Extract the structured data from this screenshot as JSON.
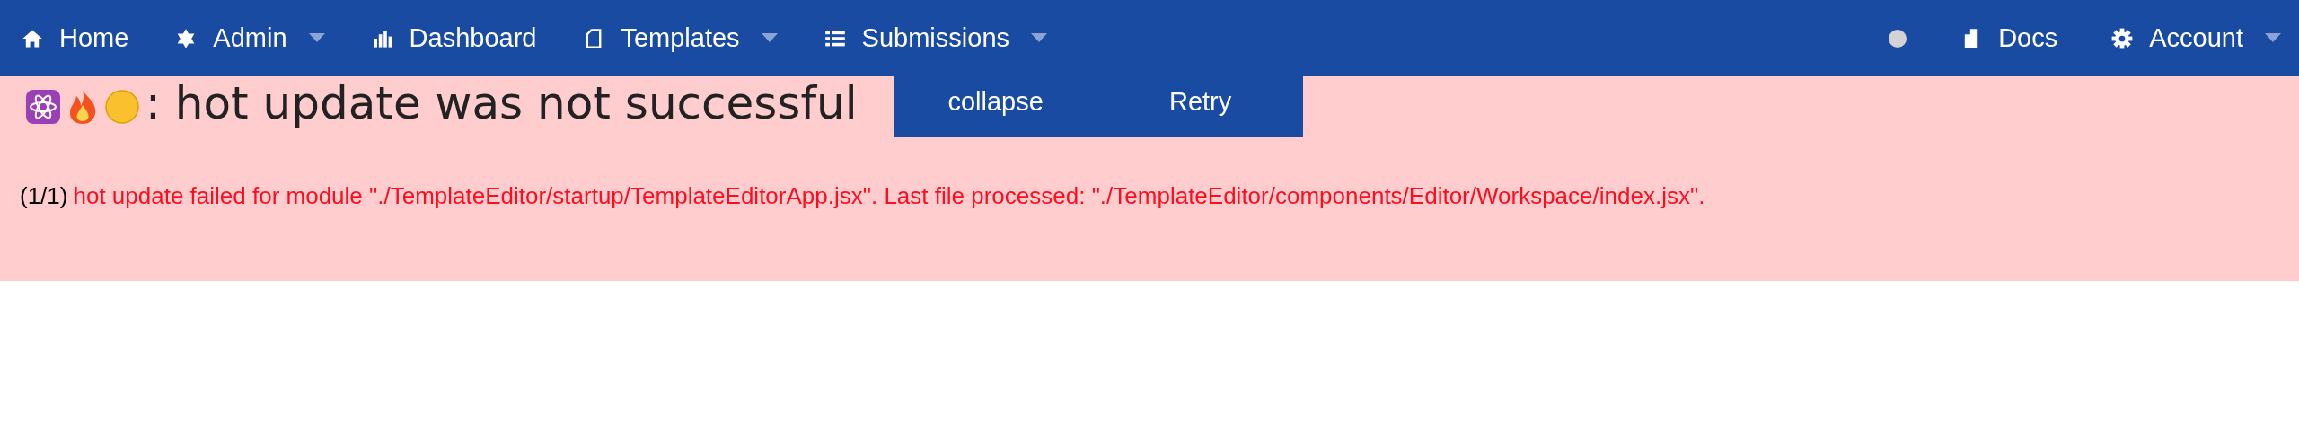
{
  "navbar": {
    "left_items": [
      {
        "label": "Home",
        "kind": "link"
      },
      {
        "label": "Admin",
        "kind": "dropdown"
      },
      {
        "label": "Dashboard",
        "kind": "link"
      },
      {
        "label": "Templates",
        "kind": "dropdown"
      },
      {
        "label": "Submissions",
        "kind": "dropdown"
      }
    ],
    "status_dot": {
      "color": "#d3d3d3"
    },
    "right_items": [
      {
        "label": "Docs",
        "kind": "link"
      },
      {
        "label": "Account",
        "kind": "dropdown"
      }
    ]
  },
  "error_overlay": {
    "heading": ": hot update was not successful",
    "buttons": [
      "collapse",
      "Retry"
    ],
    "counter": "(1/1)",
    "message": "hot update failed for module \"./TemplateEditor/startup/TemplateEditorApp.jsx\". Last file processed: \"./TemplateEditor/components/Editor/Workspace/index.jsx\"."
  }
}
